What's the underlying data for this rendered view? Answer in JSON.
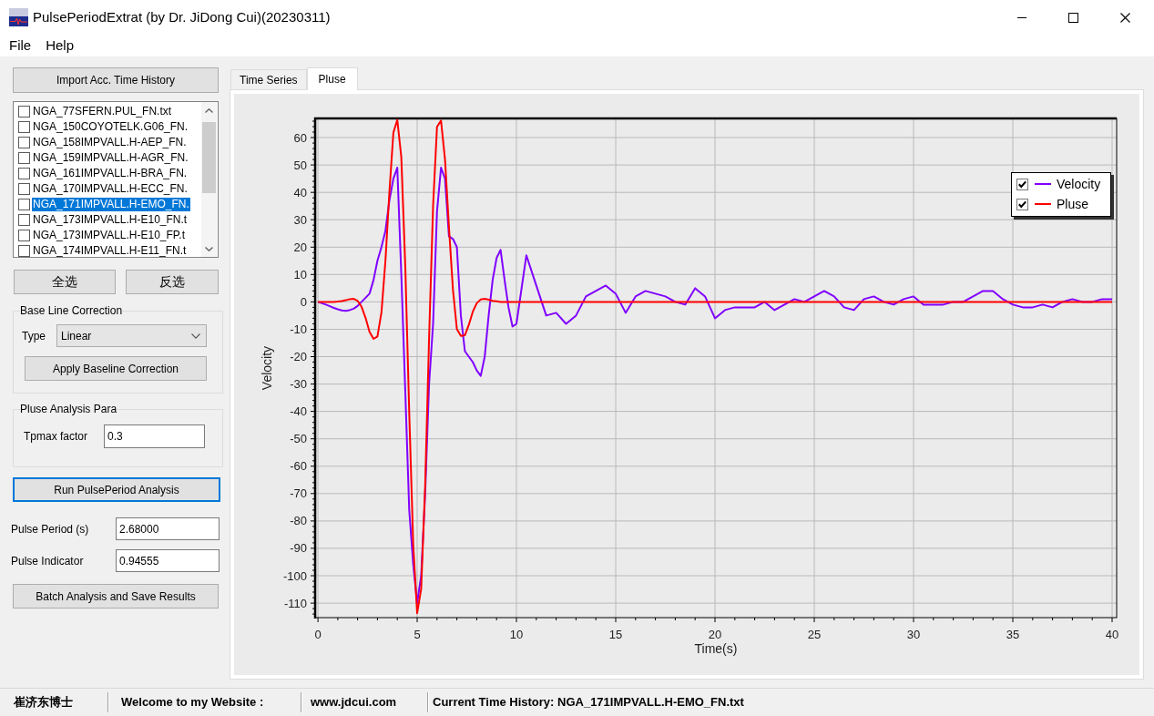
{
  "window": {
    "title": "PulsePeriodExtrat (by Dr. JiDong Cui)(20230311)"
  },
  "menu": [
    "File",
    "Help"
  ],
  "left_panel": {
    "import_button": "Import Acc. Time History",
    "files": [
      {
        "name": "NGA_77SFERN.PUL_FN.txt",
        "checked": false,
        "selected": false
      },
      {
        "name": "NGA_150COYOTELK.G06_FN.",
        "checked": false,
        "selected": false
      },
      {
        "name": "NGA_158IMPVALL.H-AEP_FN.",
        "checked": false,
        "selected": false
      },
      {
        "name": "NGA_159IMPVALL.H-AGR_FN.",
        "checked": false,
        "selected": false
      },
      {
        "name": "NGA_161IMPVALL.H-BRA_FN.",
        "checked": false,
        "selected": false
      },
      {
        "name": "NGA_170IMPVALL.H-ECC_FN.",
        "checked": false,
        "selected": false
      },
      {
        "name": "NGA_171IMPVALL.H-EMO_FN.",
        "checked": false,
        "selected": true
      },
      {
        "name": "NGA_173IMPVALL.H-E10_FN.t",
        "checked": false,
        "selected": false
      },
      {
        "name": "NGA_173IMPVALL.H-E10_FP.t",
        "checked": false,
        "selected": false
      },
      {
        "name": "NGA_174IMPVALL.H-E11_FN.t",
        "checked": false,
        "selected": false
      }
    ],
    "select_buttons": [
      "全选",
      "反选"
    ],
    "baseline_group": {
      "title": "Base Line Correction",
      "type_label": "Type",
      "type_value": "Linear",
      "apply_button": "Apply Baseline Correction"
    },
    "pulse_group": {
      "title": "Pluse Analysis Para",
      "factor_label": "Tpmax factor",
      "factor_value": "0.3"
    },
    "run_button": {
      "label": "Run PulsePeriod Analysis",
      "focused": true
    },
    "results": [
      {
        "label": "Pulse Period (s)",
        "value": "2.68000"
      },
      {
        "label": "Pulse Indicator",
        "value": "0.94555"
      }
    ],
    "batch_button": "Batch Analysis and Save Results"
  },
  "tabs": [
    {
      "label": "Time Series",
      "selected": false
    },
    {
      "label": "Pluse",
      "selected": true
    }
  ],
  "chart": {
    "legend_items": [
      {
        "checked": true
      },
      {
        "checked": true
      }
    ],
    "chart_data": {
      "type": "line",
      "xlabel": "Time(s)",
      "ylabel": "Velocity",
      "x": [
        0,
        0.2,
        0.4,
        0.6,
        0.8,
        1,
        1.2,
        1.4,
        1.6,
        1.8,
        2,
        2.2,
        2.4,
        2.6,
        2.8,
        3,
        3.2,
        3.4,
        3.6,
        3.8,
        4,
        4.2,
        4.4,
        4.6,
        4.8,
        5,
        5.2,
        5.4,
        5.6,
        5.8,
        6,
        6.2,
        6.4,
        6.6,
        6.8,
        7,
        7.2,
        7.4,
        7.6,
        7.8,
        8,
        8.2,
        8.4,
        8.6,
        8.8,
        9,
        9.2,
        9.4,
        9.6,
        9.8,
        10,
        10.5,
        11,
        11.5,
        12,
        12.5,
        13,
        13.5,
        14,
        14.5,
        15,
        15.5,
        16,
        16.5,
        17,
        17.5,
        18,
        18.5,
        19,
        19.5,
        20,
        20.5,
        21,
        21.5,
        22,
        22.5,
        23,
        23.5,
        24,
        24.5,
        25,
        25.5,
        26,
        26.5,
        27,
        27.5,
        28,
        28.5,
        29,
        29.5,
        30,
        30.5,
        31,
        31.5,
        32,
        32.5,
        33,
        33.5,
        34,
        34.5,
        35,
        35.5,
        36,
        36.5,
        37,
        37.5,
        38,
        38.5,
        39,
        39.5,
        40
      ],
      "series": [
        {
          "name": "Velocity",
          "color": "#8000ff",
          "values": [
            0,
            -0.5,
            -1,
            -1.6,
            -2.2,
            -2.7,
            -3.1,
            -3.3,
            -3,
            -2.5,
            -1.5,
            0,
            1.5,
            3,
            8,
            15,
            20,
            26,
            37,
            45,
            49,
            10,
            -33,
            -76,
            -96,
            -110,
            -100,
            -70,
            -30,
            -8,
            33,
            49,
            45,
            24,
            23,
            20,
            -5,
            -18,
            -20,
            -22,
            -25,
            -27,
            -20,
            -5,
            8,
            16,
            19,
            8,
            -2,
            -9,
            -8,
            17,
            6,
            -5,
            -4,
            -8,
            -5,
            2,
            4,
            6,
            3,
            -4,
            2,
            4,
            3,
            2,
            0,
            -1,
            5,
            2,
            -6,
            -3,
            -2,
            -2,
            -2,
            0,
            -3,
            -1,
            1,
            0,
            2,
            4,
            2,
            -2,
            -3,
            1,
            2,
            0,
            -1,
            1,
            2,
            -1,
            -1,
            -1,
            0,
            0,
            2,
            4,
            4,
            1,
            -1,
            -2,
            -2,
            -1,
            -2,
            0,
            1,
            0,
            0,
            1,
            1
          ]
        },
        {
          "name": "Pluse",
          "color": "#ff0000",
          "values": [
            0,
            0,
            0,
            0,
            0,
            0.1,
            0.3,
            0.6,
            1,
            1.1,
            0.4,
            -1.8,
            -5.9,
            -10.9,
            -13.5,
            -12.6,
            -3.9,
            15.1,
            40,
            61.8,
            66.5,
            52.9,
            12.7,
            -40.4,
            -88.7,
            -113.7,
            -104.9,
            -66.9,
            -13.3,
            35.1,
            63.9,
            66.2,
            52,
            27.4,
            4.5,
            -9.9,
            -12.4,
            -12.2,
            -8.4,
            -3.6,
            -0.5,
            0.9,
            1.1,
            0.8,
            0.4,
            0.2,
            0,
            0,
            0,
            0,
            0,
            0,
            0,
            0,
            0,
            0,
            0,
            0,
            0,
            0,
            0,
            0,
            0,
            0,
            0,
            0,
            0,
            0,
            0,
            0,
            0,
            0,
            0,
            0,
            0,
            0,
            0,
            0,
            0,
            0,
            0,
            0,
            0,
            0,
            0,
            0,
            0,
            0,
            0,
            0,
            0,
            0,
            0,
            0,
            0,
            0,
            0,
            0,
            0,
            0,
            0,
            0,
            0,
            0,
            0,
            0,
            0,
            0,
            0,
            0,
            0
          ]
        }
      ],
      "xlim": [
        -0.14,
        40.23
      ],
      "ylim": [
        -115.3,
        67
      ],
      "xticks": [
        0,
        5,
        10,
        15,
        20,
        25,
        30,
        35,
        40
      ],
      "yticks": [
        60,
        50,
        40,
        30,
        20,
        10,
        0,
        -10,
        -20,
        -30,
        -40,
        -50,
        -60,
        -70,
        -80,
        -90,
        -100,
        -110
      ],
      "grid": true,
      "legend": true
    }
  },
  "status_bar": [
    "崔济东博士",
    "Welcome to my Website :",
    "www.jdcui.com",
    "Current Time History: NGA_171IMPVALL.H-EMO_FN.txt"
  ]
}
